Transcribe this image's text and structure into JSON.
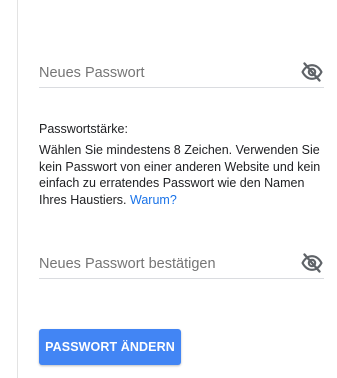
{
  "form": {
    "new_password": {
      "placeholder": "Neues Passwort",
      "value": "",
      "toggle_icon": "eye-off-icon"
    },
    "strength": {
      "title": "Passwortstärke:",
      "description": "Wählen Sie mindestens 8 Zeichen. Verwenden Sie kein Passwort von einer anderen Website und kein einfach zu erratendes Passwort wie den Namen Ihres Haustiers.",
      "link_label": "Warum?"
    },
    "confirm_password": {
      "placeholder": "Neues Passwort bestätigen",
      "value": "",
      "toggle_icon": "eye-off-icon"
    },
    "submit_label": "PASSWORT ÄNDERN"
  },
  "colors": {
    "accent": "#4285f4",
    "link": "#1a73e8",
    "icon": "#5f6368"
  }
}
